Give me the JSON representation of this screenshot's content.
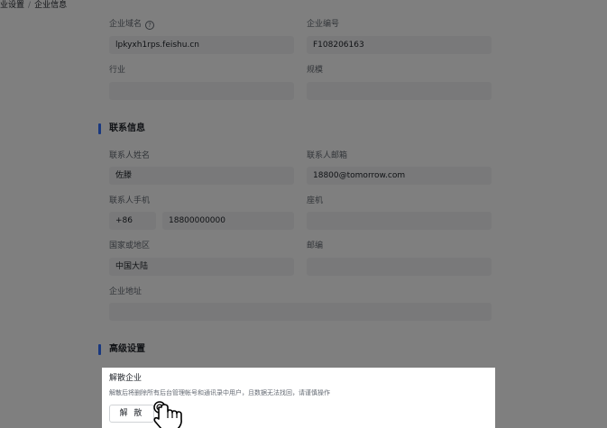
{
  "breadcrumb": {
    "parent": "业设置",
    "separator": "/",
    "current": "企业信息"
  },
  "basic": {
    "domain_label": "企业域名",
    "domain_value": "lpkyxh1rps.feishu.cn",
    "code_label": "企业编号",
    "code_value": "F108206163",
    "industry_label": "行业",
    "industry_value": "",
    "scale_label": "规模",
    "scale_value": ""
  },
  "contact": {
    "section_title": "联系信息",
    "name_label": "联系人姓名",
    "name_value": "佐滕",
    "email_label": "联系人邮箱",
    "email_value": "18800@tomorrow.com",
    "phone_label": "联系人手机",
    "phone_code": "+86",
    "phone_value": "18800000000",
    "landline_label": "座机",
    "landline_value": "",
    "region_label": "国家或地区",
    "region_value": "中国大陆",
    "postcode_label": "邮编",
    "postcode_value": "",
    "address_label": "企业地址",
    "address_value": ""
  },
  "advanced": {
    "section_title": "高级设置",
    "dissolve_title": "解散企业",
    "dissolve_desc": "解散后将删除所有后台管理帐号和通讯录中用户，且数据无法找回，请谨慎操作",
    "dissolve_button": "解 散"
  },
  "colors": {
    "accent": "#3370ff",
    "field_bg": "#f2f3f5",
    "overlay": "#7f7f7f"
  }
}
